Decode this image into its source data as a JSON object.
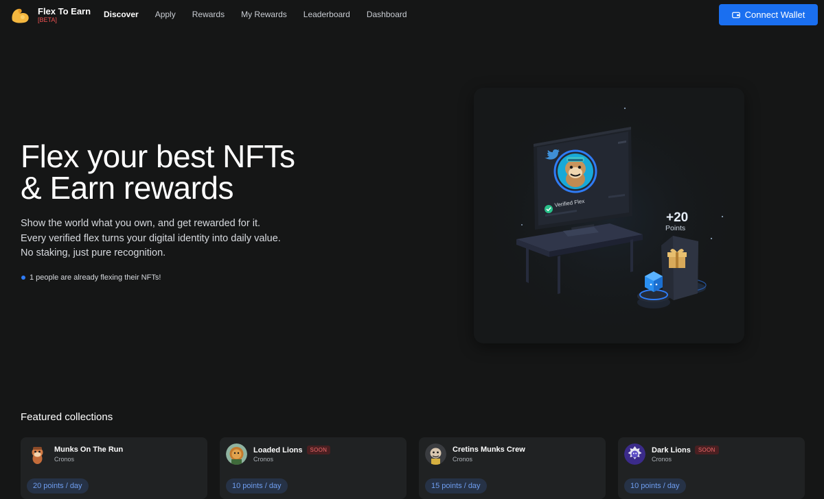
{
  "app": {
    "name": "Flex To Earn",
    "tag": "[BETA]"
  },
  "nav": {
    "links": [
      {
        "label": "Discover",
        "active": true
      },
      {
        "label": "Apply"
      },
      {
        "label": "Rewards"
      },
      {
        "label": "My Rewards"
      },
      {
        "label": "Leaderboard"
      },
      {
        "label": "Dashboard"
      }
    ],
    "connect_label": "Connect Wallet"
  },
  "hero": {
    "title_line1": "Flex your best NFTs",
    "title_line2": "& Earn rewards",
    "sub_line1": "Show the world what you own, and get rewarded for it.",
    "sub_line2": "Every verified flex turns your digital identity into daily value.",
    "sub_line3": "No staking, just pure recognition.",
    "stat": "1 people are already flexing their NFTs!"
  },
  "illustration": {
    "verified_label": "Verified Flex",
    "points_value": "+20",
    "points_label": "Points"
  },
  "featured": {
    "title": "Featured collections",
    "collections": [
      {
        "name": "Munks On The Run",
        "chain": "Cronos",
        "points": "20 points / day",
        "badge": ""
      },
      {
        "name": "Loaded Lions",
        "chain": "Cronos",
        "points": "10 points / day",
        "badge": "SOON"
      },
      {
        "name": "Cretins Munks Crew",
        "chain": "Cronos",
        "points": "15 points / day",
        "badge": ""
      },
      {
        "name": "Dark Lions",
        "chain": "Cronos",
        "points": "10 points / day",
        "badge": "SOON"
      }
    ]
  },
  "colors": {
    "background": "#151616",
    "accent": "#1a6ff0",
    "card": "#202223",
    "soon": "#ef6b6b",
    "points": "#6f9ef0"
  }
}
